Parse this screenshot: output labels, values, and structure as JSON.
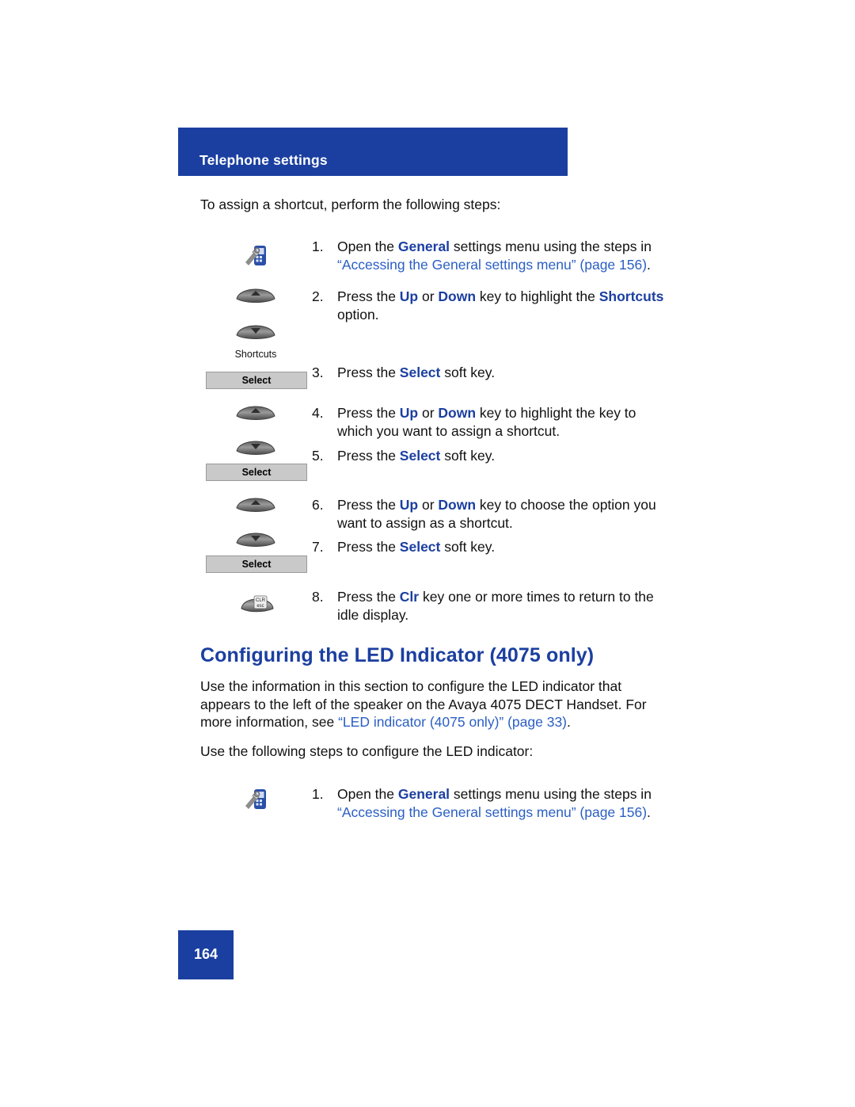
{
  "header": {
    "title": "Telephone settings"
  },
  "intro": "To assign a shortcut, perform the following steps:",
  "steps": [
    {
      "num": "1.",
      "text_a": "Open the ",
      "bold_a": "General",
      "text_b": " settings menu using the steps in ",
      "link": "“Accessing the General settings menu” (page 156)",
      "text_c": "."
    },
    {
      "num": "2.",
      "text_a": "Press the ",
      "bold_a": "Up",
      "text_b": " or ",
      "bold_b": "Down",
      "text_c": " key to highlight the ",
      "bold_c": "Shortcuts",
      "text_d": " option."
    },
    {
      "num": "3.",
      "text_a": "Press the ",
      "bold_a": "Select",
      "text_b": " soft key."
    },
    {
      "num": "4.",
      "text_a": "Press the ",
      "bold_a": "Up",
      "text_b": " or ",
      "bold_b": "Down",
      "text_c": " key to highlight the key to which you want to assign a shortcut."
    },
    {
      "num": "5.",
      "text_a": "Press the ",
      "bold_a": "Select",
      "text_b": " soft key."
    },
    {
      "num": "6.",
      "text_a": "Press the ",
      "bold_a": "Up",
      "text_b": " or ",
      "bold_b": "Down",
      "text_c": " key to choose the option you want to assign as a shortcut."
    },
    {
      "num": "7.",
      "text_a": "Press the ",
      "bold_a": "Select",
      "text_b": " soft key."
    },
    {
      "num": "8.",
      "text_a": "Press the ",
      "bold_a": "Clr",
      "text_b": " key one or more times to return to the idle display."
    }
  ],
  "icons": {
    "shortcuts_caption": "Shortcuts",
    "softkey_label": "Select",
    "clr_label_top": "CLR",
    "clr_label_bottom": "esc"
  },
  "section": {
    "heading": "Configuring the LED Indicator (4075 only)",
    "para1_a": "Use the information in this section to configure the LED indicator that appears to the left of the speaker on the Avaya 4075 DECT Handset. For more information, see ",
    "para1_link": "“LED indicator (4075 only)” (page 33)",
    "para1_b": ".",
    "para2": "Use the following steps to configure the LED indicator:",
    "step1": {
      "num": "1.",
      "text_a": "Open the ",
      "bold_a": "General",
      "text_b": " settings menu using the steps in ",
      "link": "“Accessing the General settings menu” (page 156)",
      "text_c": "."
    }
  },
  "page_number": "164",
  "colors": {
    "brand_blue": "#1b3fa0",
    "link_blue": "#2b5fc4",
    "softkey_gray": "#c9c9c9"
  }
}
